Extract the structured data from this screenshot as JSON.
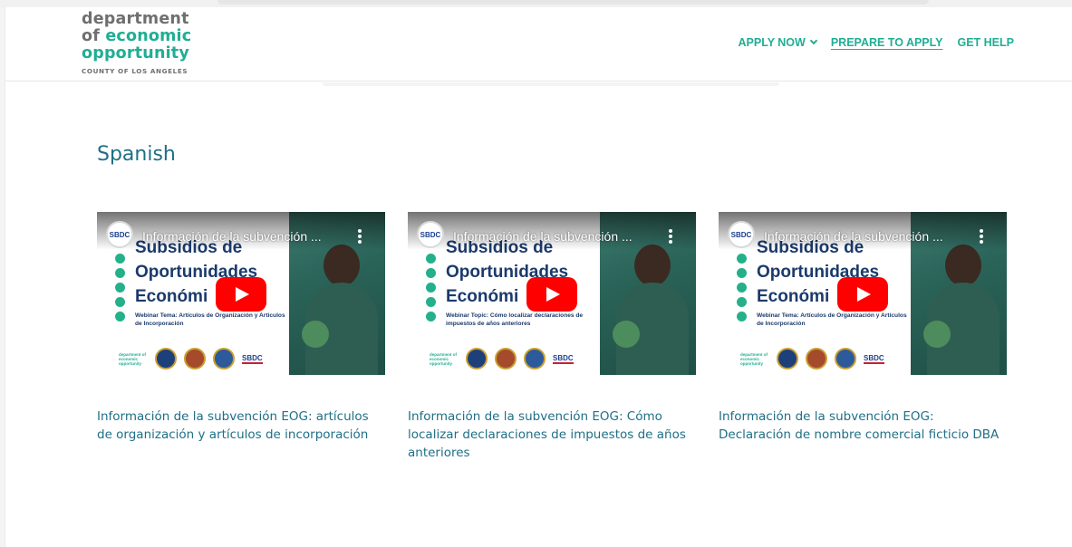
{
  "header": {
    "logo": {
      "line1": "department",
      "line2_prefix": "of",
      "line2_accent": "economic",
      "line3": "opportunity",
      "tagline": "COUNTY OF LOS ANGELES"
    },
    "nav": [
      {
        "label": "APPLY NOW",
        "has_dropdown": true
      },
      {
        "label": "PREPARE TO APPLY",
        "active": true
      },
      {
        "label": "GET HELP"
      }
    ]
  },
  "section": {
    "title": "Spanish"
  },
  "videos": [
    {
      "thumb_title": "Información de la subvención ...",
      "channel": "SBDC",
      "headline_lines": [
        "Subsidios de",
        "Oportunidades",
        "Económi"
      ],
      "topic": "Webinar Tema: Artículos de Organización y Artículos de Incorporación",
      "badge_text": "SBDC",
      "caption": "Información de la subvención EOG: artículos de organización y artículos de incorporación"
    },
    {
      "thumb_title": "Información de la subvención ...",
      "channel": "SBDC",
      "headline_lines": [
        "Subsidios de",
        "Oportunidades",
        "Económi"
      ],
      "topic": "Webinar Topic: Cómo localizar declaraciones de impuestos de años anteriores",
      "badge_text": "SBDC",
      "caption": "Información de la subvención EOG: Cómo localizar declaraciones de impuestos de años anteriores"
    },
    {
      "thumb_title": "Información de la subvención ...",
      "channel": "SBDC",
      "headline_lines": [
        "Subsidios de",
        "Oportunidades",
        "Económi"
      ],
      "topic": "Webinar Tema: Artículos de Organización y Artículos de Incorporación",
      "badge_text": "SBDC",
      "caption": "Información de la subvención EOG: Declaración de nombre comercial ficticio DBA"
    }
  ],
  "colors": {
    "brand_teal": "#1fae94",
    "brand_gray": "#6f6f6f",
    "heading_blue": "#1e6f86",
    "play_red": "#ff0000"
  }
}
